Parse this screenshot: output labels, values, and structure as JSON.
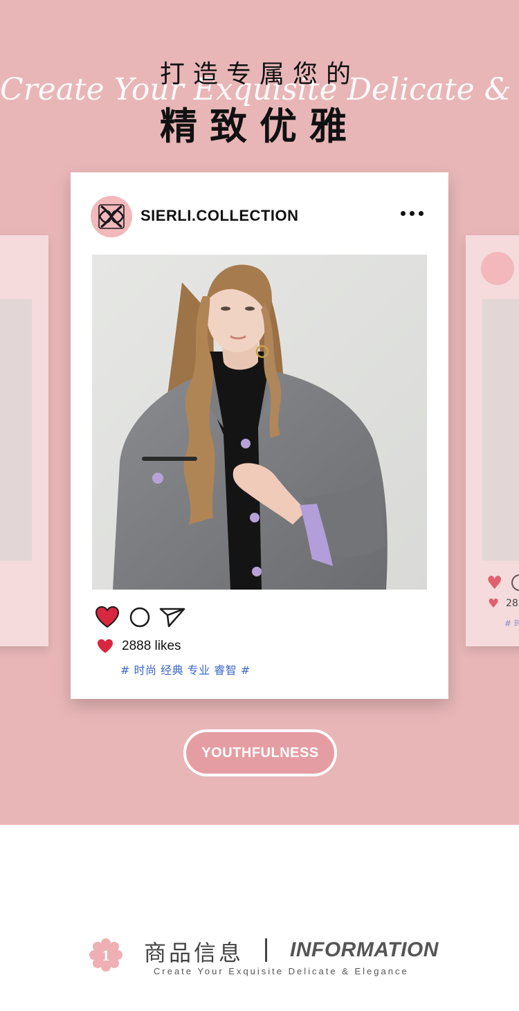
{
  "hero": {
    "title_line1": "打造专属您的",
    "title_line2": "精致优雅",
    "script_text": "Create Your Exquisite Delicate & Elegance",
    "background_color": "#e8b6b7"
  },
  "post": {
    "username": "SIERLI.COLLECTION",
    "avatar_icon": "brand-monogram-logo",
    "more_icon": "more-dots-icon",
    "photo": "model wearing grey wool coat with lavender lining over black turtleneck",
    "actions": {
      "like_icon": "heart-icon",
      "comment_icon": "comment-circle-icon",
      "share_icon": "paper-plane-icon"
    },
    "likes_text": "2888 likes",
    "tags_text": "# 时尚 经典 专业 睿智 #"
  },
  "side_right": {
    "likes_text": "28",
    "tags_text": "# 时"
  },
  "badge": {
    "label": "YOUTHFULNESS"
  },
  "section": {
    "number": "1",
    "title_cn": "商品信息",
    "title_en": "INFORMATION",
    "subtitle": "Create Your Exquisite Delicate & Elegance"
  },
  "colors": {
    "accent_pink": "#e8b6b7",
    "heart_red": "#d8283f",
    "tag_blue": "#3c67c4"
  }
}
